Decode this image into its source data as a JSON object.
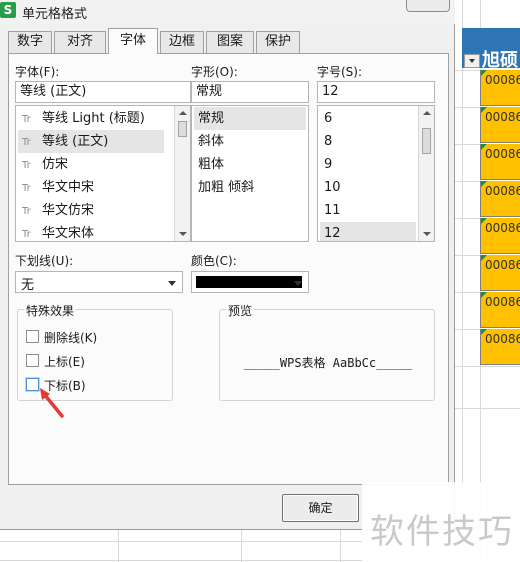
{
  "window": {
    "title": "单元格格式",
    "app_icon": "S"
  },
  "tabs": [
    {
      "label": "数字"
    },
    {
      "label": "对齐"
    },
    {
      "label": "字体"
    },
    {
      "label": "边框"
    },
    {
      "label": "图案"
    },
    {
      "label": "保护"
    }
  ],
  "active_tab": "字体",
  "font": {
    "label": "字体(F):",
    "value": "等线 (正文)",
    "items": [
      "等线 Light (标题)",
      "等线 (正文)",
      "仿宋",
      "华文中宋",
      "华文仿宋",
      "华文宋体"
    ],
    "selected": "等线 (正文)"
  },
  "style": {
    "label": "字形(O):",
    "value": "常规",
    "items": [
      "常规",
      "斜体",
      "粗体",
      "加粗 倾斜"
    ],
    "selected": "常规"
  },
  "size": {
    "label": "字号(S):",
    "value": "12",
    "items": [
      "6",
      "8",
      "9",
      "10",
      "11",
      "12"
    ],
    "selected": "12"
  },
  "underline": {
    "label": "下划线(U):",
    "value": "无"
  },
  "color": {
    "label": "颜色(C):",
    "value_hex": "#000000"
  },
  "effects": {
    "title": "特殊效果",
    "strikethrough": {
      "label": "删除线(K)",
      "checked": false
    },
    "superscript": {
      "label": "上标(E)",
      "checked": false
    },
    "subscript": {
      "label": "下标(B)",
      "checked": false
    }
  },
  "preview": {
    "title": "预览",
    "text": "_____WPS表格  AaBbCc_____"
  },
  "buttons": {
    "ok": "确定"
  },
  "sheet": {
    "header_text": "旭硕",
    "cells": [
      "00086",
      "00086",
      "00086",
      "00086",
      "00086",
      "00086",
      "00086",
      "00086"
    ],
    "header_color": "#2e75b6",
    "cell_color": "#ffc000"
  },
  "watermark": "软件技巧"
}
